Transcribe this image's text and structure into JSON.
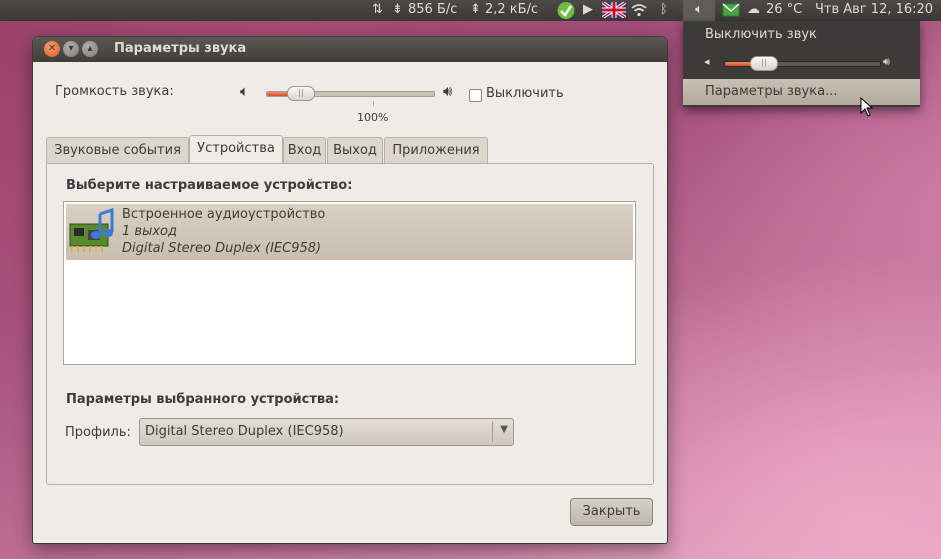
{
  "panel": {
    "net_down": "856 Б/с",
    "net_up": "2,2 кБ/с",
    "weather": "26 °C",
    "clock": "Чтв Авг 12, 16:20",
    "icons": [
      "network-arrows-icon",
      "download-icon",
      "upload-icon",
      "check-icon",
      "play-icon",
      "uk-flag-icon",
      "wifi-icon",
      "bluetooth-icon",
      "volume-icon",
      "mail-icon",
      "weather-icon"
    ]
  },
  "menu": {
    "mute": "Выключить звук",
    "volume_level": 0.25,
    "settings": "Параметры звука..."
  },
  "window": {
    "title": "Параметры звука",
    "volume_label": "Громкость звука:",
    "volume_percent": "100%",
    "volume_level": 0.2,
    "mute_label": "Выключить",
    "tabs": [
      "Звуковые события",
      "Устройства",
      "Вход",
      "Выход",
      "Приложения"
    ],
    "active_tab": "Устройства",
    "choose_device_heading": "Выберите настраиваемое устройство:",
    "device": {
      "name": "Встроенное аудиоустройство",
      "outputs": "1 выход",
      "profile": "Digital Stereo Duplex (IEC958)"
    },
    "selected_device_heading": "Параметры выбранного устройства:",
    "profile_label": "Профиль:",
    "profile_value": "Digital Stereo Duplex (IEC958)",
    "close_button": "Закрыть"
  },
  "colors": {
    "panel_bg": "#3c3b37",
    "window_bg": "#efebe7",
    "accent_orange": "#df4a25",
    "selection": "#c9bfb0"
  }
}
